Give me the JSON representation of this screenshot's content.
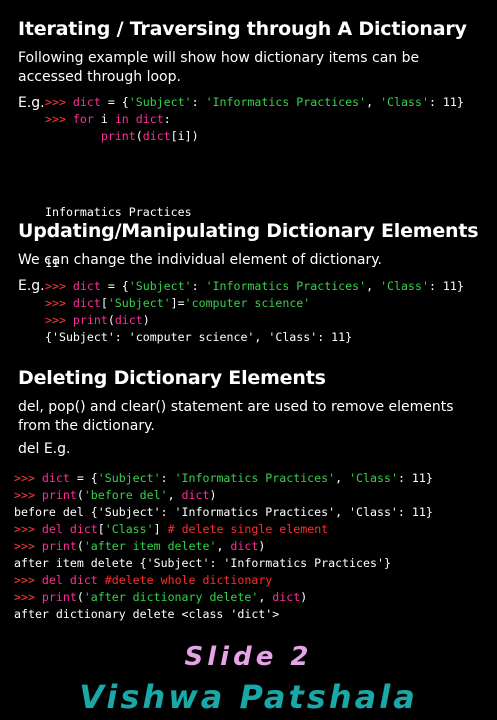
{
  "section1": {
    "title": "Iterating / Traversing through A Dictionary",
    "desc": "Following example will show how dictionary items can be accessed through loop.",
    "eg": "E.g.",
    "code": [
      [
        {
          "t": ">>> ",
          "c": "p"
        },
        {
          "t": "dict",
          "c": "kw"
        },
        {
          "t": " = {",
          "c": "n"
        },
        {
          "t": "'Subject'",
          "c": "s"
        },
        {
          "t": ": ",
          "c": "n"
        },
        {
          "t": "'Informatics Practices'",
          "c": "s"
        },
        {
          "t": ", ",
          "c": "n"
        },
        {
          "t": "'Class'",
          "c": "s"
        },
        {
          "t": ": 11}",
          "c": "n"
        }
      ],
      [
        {
          "t": ">>> ",
          "c": "p"
        },
        {
          "t": "for",
          "c": "kw"
        },
        {
          "t": " i ",
          "c": "n"
        },
        {
          "t": "in",
          "c": "kw"
        },
        {
          "t": " ",
          "c": "n"
        },
        {
          "t": "dict",
          "c": "kw"
        },
        {
          "t": ":",
          "c": "n"
        }
      ],
      [
        {
          "t": "        ",
          "c": "n"
        },
        {
          "t": "print",
          "c": "kw"
        },
        {
          "t": "(",
          "c": "n"
        },
        {
          "t": "dict",
          "c": "kw"
        },
        {
          "t": "[i])",
          "c": "n"
        }
      ]
    ],
    "output": [
      "Informatics Practices",
      "11"
    ]
  },
  "section2": {
    "title": "Updating/Manipulating Dictionary Elements",
    "desc": "We can change the individual element of dictionary.",
    "eg": "E.g.",
    "code": [
      [
        {
          "t": ">>> ",
          "c": "p"
        },
        {
          "t": "dict",
          "c": "kw"
        },
        {
          "t": " = {",
          "c": "n"
        },
        {
          "t": "'Subject'",
          "c": "s"
        },
        {
          "t": ": ",
          "c": "n"
        },
        {
          "t": "'Informatics Practices'",
          "c": "s"
        },
        {
          "t": ", ",
          "c": "n"
        },
        {
          "t": "'Class'",
          "c": "s"
        },
        {
          "t": ": 11}",
          "c": "n"
        }
      ],
      [
        {
          "t": ">>> ",
          "c": "p"
        },
        {
          "t": "dict",
          "c": "kw"
        },
        {
          "t": "[",
          "c": "n"
        },
        {
          "t": "'Subject'",
          "c": "s"
        },
        {
          "t": "]=",
          "c": "n"
        },
        {
          "t": "'computer science'",
          "c": "s"
        }
      ],
      [
        {
          "t": ">>> ",
          "c": "p"
        },
        {
          "t": "print",
          "c": "kw"
        },
        {
          "t": "(",
          "c": "n"
        },
        {
          "t": "dict",
          "c": "kw"
        },
        {
          "t": ")",
          "c": "n"
        }
      ],
      [
        {
          "t": "{'Subject': 'computer science', 'Class': 11}",
          "c": "n"
        }
      ]
    ]
  },
  "section3": {
    "title": "Deleting Dictionary Elements",
    "desc": "del, pop() and clear() statement are used to remove elements from the dictionary.",
    "eg": "del E.g.",
    "code": [
      [
        {
          "t": ">>> ",
          "c": "p"
        },
        {
          "t": "dict",
          "c": "kw"
        },
        {
          "t": " = {",
          "c": "n"
        },
        {
          "t": "'Subject'",
          "c": "s"
        },
        {
          "t": ": ",
          "c": "n"
        },
        {
          "t": "'Informatics Practices'",
          "c": "s"
        },
        {
          "t": ", ",
          "c": "n"
        },
        {
          "t": "'Class'",
          "c": "s"
        },
        {
          "t": ": 11}",
          "c": "n"
        }
      ],
      [
        {
          "t": ">>> ",
          "c": "p"
        },
        {
          "t": "print",
          "c": "kw"
        },
        {
          "t": "(",
          "c": "n"
        },
        {
          "t": "'before del'",
          "c": "s"
        },
        {
          "t": ", ",
          "c": "n"
        },
        {
          "t": "dict",
          "c": "kw"
        },
        {
          "t": ")",
          "c": "n"
        }
      ],
      [
        {
          "t": "before del {'Subject': 'Informatics Practices', 'Class': 11}",
          "c": "n"
        }
      ],
      [
        {
          "t": ">>> ",
          "c": "p"
        },
        {
          "t": "del",
          "c": "kw"
        },
        {
          "t": " ",
          "c": "n"
        },
        {
          "t": "dict",
          "c": "kw"
        },
        {
          "t": "[",
          "c": "n"
        },
        {
          "t": "'Class'",
          "c": "s"
        },
        {
          "t": "] ",
          "c": "n"
        },
        {
          "t": "# delete single element",
          "c": "c"
        }
      ],
      [
        {
          "t": ">>> ",
          "c": "p"
        },
        {
          "t": "print",
          "c": "kw"
        },
        {
          "t": "(",
          "c": "n"
        },
        {
          "t": "'after item delete'",
          "c": "s"
        },
        {
          "t": ", ",
          "c": "n"
        },
        {
          "t": "dict",
          "c": "kw"
        },
        {
          "t": ")",
          "c": "n"
        }
      ],
      [
        {
          "t": "after item delete {'Subject': 'Informatics Practices'}",
          "c": "n"
        }
      ],
      [
        {
          "t": ">>> ",
          "c": "p"
        },
        {
          "t": "del",
          "c": "kw"
        },
        {
          "t": " ",
          "c": "n"
        },
        {
          "t": "dict",
          "c": "kw"
        },
        {
          "t": " ",
          "c": "n"
        },
        {
          "t": "#delete whole dictionary",
          "c": "c"
        }
      ],
      [
        {
          "t": ">>> ",
          "c": "p"
        },
        {
          "t": "print",
          "c": "kw"
        },
        {
          "t": "(",
          "c": "n"
        },
        {
          "t": "'after dictionary delete'",
          "c": "s"
        },
        {
          "t": ", ",
          "c": "n"
        },
        {
          "t": "dict",
          "c": "kw"
        },
        {
          "t": ")",
          "c": "n"
        }
      ],
      [
        {
          "t": "after dictionary delete <class 'dict'>",
          "c": "n"
        }
      ]
    ]
  },
  "footer": {
    "slide": "Slide 2",
    "brand": "Vishwa Patshala"
  }
}
